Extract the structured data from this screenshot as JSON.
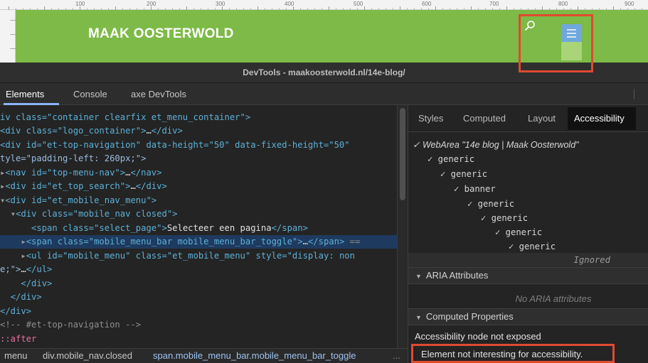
{
  "site": {
    "ruler_ticks": [
      "100",
      "200",
      "300",
      "400",
      "500",
      "600",
      "700",
      "800",
      "900"
    ],
    "title": "MAAK OOSTERWOLD",
    "icons": {
      "search": "search-icon",
      "menu": "hamburger-menu-icon"
    },
    "colors": {
      "header_green": "#7dba47",
      "menu_blue": "#6fa8dc",
      "highlight_red": "#e04a2f"
    }
  },
  "devtools": {
    "window_title": "DevTools - maakoosterwold.nl/14e-blog/",
    "tabs": [
      {
        "label": "Elements"
      },
      {
        "label": "Console"
      },
      {
        "label": "axe DevTools"
      }
    ],
    "elements": {
      "line1": {
        "tag_open": "iv class=\"container clearfix et_menu_container\">"
      },
      "line2": {
        "a": "<div class=\"logo_container\">",
        "b": "…",
        "c": "</div>"
      },
      "line3": {
        "a": "<div id=\"et-top-navigation\" data-height=\"50\" data-fixed-height=\"50\""
      },
      "line4": {
        "a": "tyle=\"padding-left: 260px;\">"
      },
      "line5": {
        "arrow": "▸",
        "a": "<nav id=\"top-menu-nav\">",
        "b": "…",
        "c": "</nav>"
      },
      "line6": {
        "arrow": "▸",
        "a": "<div id=\"et_top_search\">",
        "b": "…",
        "c": "</div>"
      },
      "line7": {
        "arrow": "▾",
        "a": "<div id=\"et_mobile_nav_menu\">"
      },
      "line8": {
        "arrow": "▾",
        "a": "<div class=\"mobile_nav closed\">"
      },
      "line9": {
        "a": "<span class=\"select_page\">",
        "b": "Selecteer een pagina",
        "c": "</span>"
      },
      "line10": {
        "arrow": "▸",
        "a": "<span class=\"mobile_menu_bar mobile_menu_bar_toggle\">",
        "b": "…",
        "c": "</span>",
        "d": " =="
      },
      "line11": {
        "arrow": "▸",
        "a": "<ul id=\"mobile_menu\" class=\"et_mobile_menu\" style=\"display: non"
      },
      "line12": {
        "a": "e;\">",
        "b": "…",
        "c": "</ul>"
      },
      "line13": {
        "a": "</div>"
      },
      "line14": {
        "a": "</div>"
      },
      "line15": {
        "a": "</div>"
      },
      "line16": {
        "a": "<!-- #et-top-navigation -->"
      },
      "line17": {
        "a": "::after"
      }
    },
    "breadcrumbs": [
      "menu",
      "div.mobile_nav.closed",
      "span.mobile_menu_bar.mobile_menu_bar_toggle",
      "..."
    ],
    "side_tabs": [
      {
        "label": "Styles"
      },
      {
        "label": "Computed"
      },
      {
        "label": "Layout"
      },
      {
        "label": "Accessibility"
      }
    ],
    "accessibility": {
      "tree": {
        "webarea": "✓ WebArea \"14e blog | Maak Oosterwold\"",
        "rows": [
          "✓ generic",
          "✓ generic",
          "✓ banner",
          "✓ generic",
          "✓ generic",
          "✓ generic",
          "✓ generic"
        ],
        "ignored": "Ignored"
      },
      "aria_header": "ARIA Attributes",
      "no_aria": "No ARIA attributes",
      "computed_header": "Computed Properties",
      "not_exposed": "Accessibility node not exposed",
      "not_interesting": "Element not interesting for accessibility."
    }
  }
}
